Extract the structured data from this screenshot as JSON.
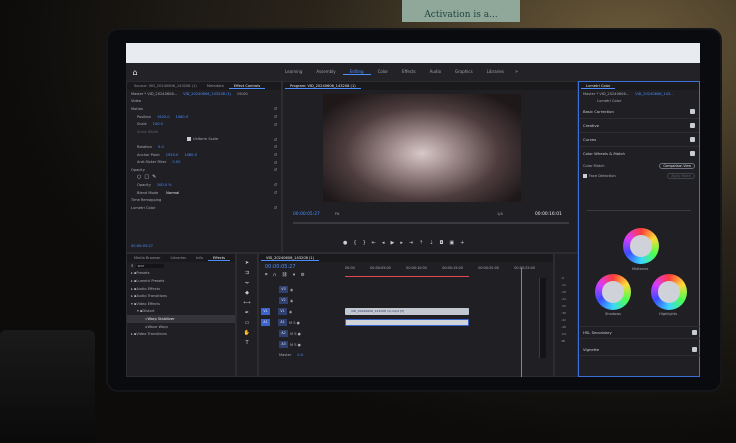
{
  "note": {
    "text": "Activation is a..."
  },
  "nav": {
    "tabs": [
      "Learning",
      "Assembly",
      "Editing",
      "Color",
      "Effects",
      "Audio",
      "Graphics",
      "Libraries"
    ],
    "active": "Editing",
    "more": "»"
  },
  "effect_controls": {
    "tabs": [
      "Source: VID_20240606_143208 (1)",
      "Metadata",
      "Effect Controls"
    ],
    "master": "Master * VID_20240606...",
    "clip": "VID_20240606_143208 (1)",
    "timecode_head": "00:00",
    "section_video": "Video",
    "motion": "Motion",
    "position_label": "Position",
    "position_x": "1920.0",
    "position_y": "1080.0",
    "scale_label": "Scale",
    "scale_val": "100.0",
    "scale_width": "Scale Width",
    "uniform_scale": "Uniform Scale",
    "rotation_label": "Rotation",
    "rotation_val": "0.0",
    "anchor_label": "Anchor Point",
    "anchor_x": "1920.0",
    "anchor_y": "1080.0",
    "antiflicker_label": "Anti-flicker Filter",
    "antiflicker_val": "0.00",
    "opacity": "Opacity",
    "opacity_label": "Opacity",
    "opacity_val": "100.0 %",
    "blend_label": "Blend Mode",
    "blend_val": "Normal",
    "time_remap": "Time Remapping",
    "lumetri": "Lumetri Color",
    "footer_tc": "00:00:05:27"
  },
  "program": {
    "title": "Program: VID_20240606_143208 (1)",
    "tc_left": "00:00:05:27",
    "fit": "Fit",
    "fraction": "1/4",
    "tc_right": "00:00:16:01"
  },
  "media_browser": {
    "tabs": [
      "Media Browser",
      "Libraries",
      "Info",
      "Effects"
    ],
    "search": "war",
    "items": [
      "Presets",
      "Lumetri Presets",
      "Audio Effects",
      "Audio Transitions",
      "Video Effects",
      "Distort",
      "Warp Stabilizer",
      "Wave Warp",
      "Video Transitions"
    ]
  },
  "timeline": {
    "title": "VID_20240606_143208 (1)",
    "tc": "00:00:05:27",
    "ruler": [
      "00:00",
      "00:00:05:00",
      "00:00:10:00",
      "00:00:15:00",
      "00:00:20:00",
      "00:00:25:00"
    ],
    "tracks": [
      "V3",
      "V2",
      "V1",
      "A1",
      "A2",
      "A3"
    ],
    "master": "Master",
    "master_val": "0.0",
    "clip_v1": "VID_20240606_143208 (1).mp4 [V]",
    "meter_ticks": [
      "-6",
      "-12",
      "-18",
      "-24",
      "-30",
      "-36",
      "-42",
      "-48",
      "-54",
      "dB"
    ]
  },
  "lumetri": {
    "title": "Lumetri Color",
    "master": "Master * VID_20240606...",
    "clip": "VID_20240606_143...",
    "effect": "Lumetri Color",
    "sections": [
      "Basic Correction",
      "Creative",
      "Curves",
      "Color Wheels & Match"
    ],
    "color_match": "Color Match",
    "comparison_view": "Comparison View",
    "face_detection": "Face Detection",
    "apply_match": "Apply Match",
    "midtones": "Midtones",
    "shadows": "Shadows",
    "highlights": "Highlights",
    "hsl": "HSL Secondary",
    "vignette": "Vignette"
  }
}
